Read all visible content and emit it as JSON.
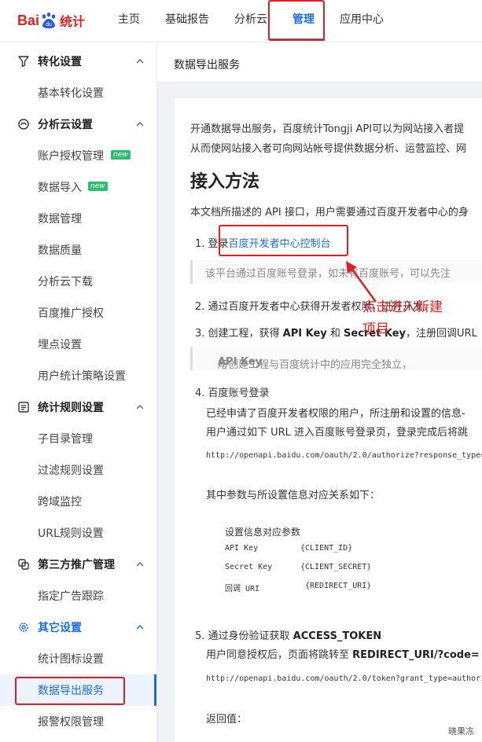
{
  "app": {
    "logo_bai": "Bai",
    "logo_du": "du",
    "logo_tongji": "统计"
  },
  "nav": {
    "items": [
      "主页",
      "基础报告",
      "分析云",
      "管理",
      "应用中心"
    ],
    "active_index": 3
  },
  "sidebar": {
    "groups": [
      {
        "label": "转化设置",
        "icon": "funnel-icon",
        "items": [
          {
            "label": "基本转化设置"
          }
        ]
      },
      {
        "label": "分析云设置",
        "icon": "cloud-icon",
        "items": [
          {
            "label": "账户授权管理",
            "badge": "new"
          },
          {
            "label": "数据导入",
            "badge": "new"
          },
          {
            "label": "数据管理"
          },
          {
            "label": "数据质量"
          },
          {
            "label": "分析云下载"
          },
          {
            "label": "百度推广授权"
          },
          {
            "label": "埋点设置"
          },
          {
            "label": "用户统计策略设置"
          }
        ]
      },
      {
        "label": "统计规则设置",
        "icon": "rules-icon",
        "items": [
          {
            "label": "子目录管理"
          },
          {
            "label": "过滤规则设置"
          },
          {
            "label": "跨域监控"
          },
          {
            "label": "URL规则设置"
          }
        ]
      },
      {
        "label": "第三方推广管理",
        "icon": "link-icon",
        "items": [
          {
            "label": "指定广告跟踪"
          }
        ]
      },
      {
        "label": "其它设置",
        "icon": "gear-icon",
        "items": [
          {
            "label": "统计图标设置"
          },
          {
            "label": "数据导出服务",
            "selected": true
          },
          {
            "label": "报警权限管理"
          }
        ]
      }
    ]
  },
  "page": {
    "title": "数据导出服务",
    "intro_line1": "开通数据导出服务，百度统计Tongji API可以为网站接入者提",
    "intro_line2": "从而使网站接入者可向网站帐号提供数据分析、运营监控、网",
    "heading": "接入方法",
    "desc": "本文档所描述的 API 接口，用户需要通过百度开发者中心的身",
    "step1_prefix": "1. 登录",
    "step1_link": "百度开发者中心控制台",
    "step1_note": "该平台通过百度账号登录，如未有百度账号，可以先注",
    "step2": "2. 通过百度开发者中心获得开发者权限，进行开发。",
    "step3_a": "3. 创建工程，获得 ",
    "step3_b": "API Key",
    "step3_c": " 和 ",
    "step3_d": "Secret Key",
    "step3_e": "，注册回调URL",
    "step3_note_a": "所创建工程与百度统计中的应用完全独立，",
    "step3_note_b": "API Key",
    "step3_note_c": " 与",
    "step4": "4. 百度账号登录",
    "step4_line1": "已经申请了百度开发者权限的用户，所注册和设置的信息-",
    "step4_line2": "用户通过如下 URL 进入百度账号登录页，登录完成后将跳",
    "url1": "http://openapi.baidu.com/oauth/2.0/authorize?response_type=",
    "params_intro": "其中参数与所设置信息对应关系如下：",
    "params_title": "设置信息对应参数",
    "params": [
      {
        "k": "API Key",
        "v": "{CLIENT_ID}"
      },
      {
        "k": "Secret Key",
        "v": "{CLIENT_SECRET}"
      },
      {
        "k": "回调 URI",
        "v": "{REDIRECT_URI}"
      }
    ],
    "step5_a": "5. 通过身份验证获取 ",
    "step5_b": "ACCESS_TOKEN",
    "step5_line1_a": "用户同意授权后，页面将跳转至 ",
    "step5_line1_b": "REDIRECT_URI/?code=",
    "url2": "http://openapi.baidu.com/oauth/2.0/token?grant_type=authori",
    "return_label": "返回值："
  },
  "annotation": {
    "line1": "点击进入新建",
    "line2": "项目",
    "color": "#e02020"
  },
  "watermark": "晓果冻"
}
